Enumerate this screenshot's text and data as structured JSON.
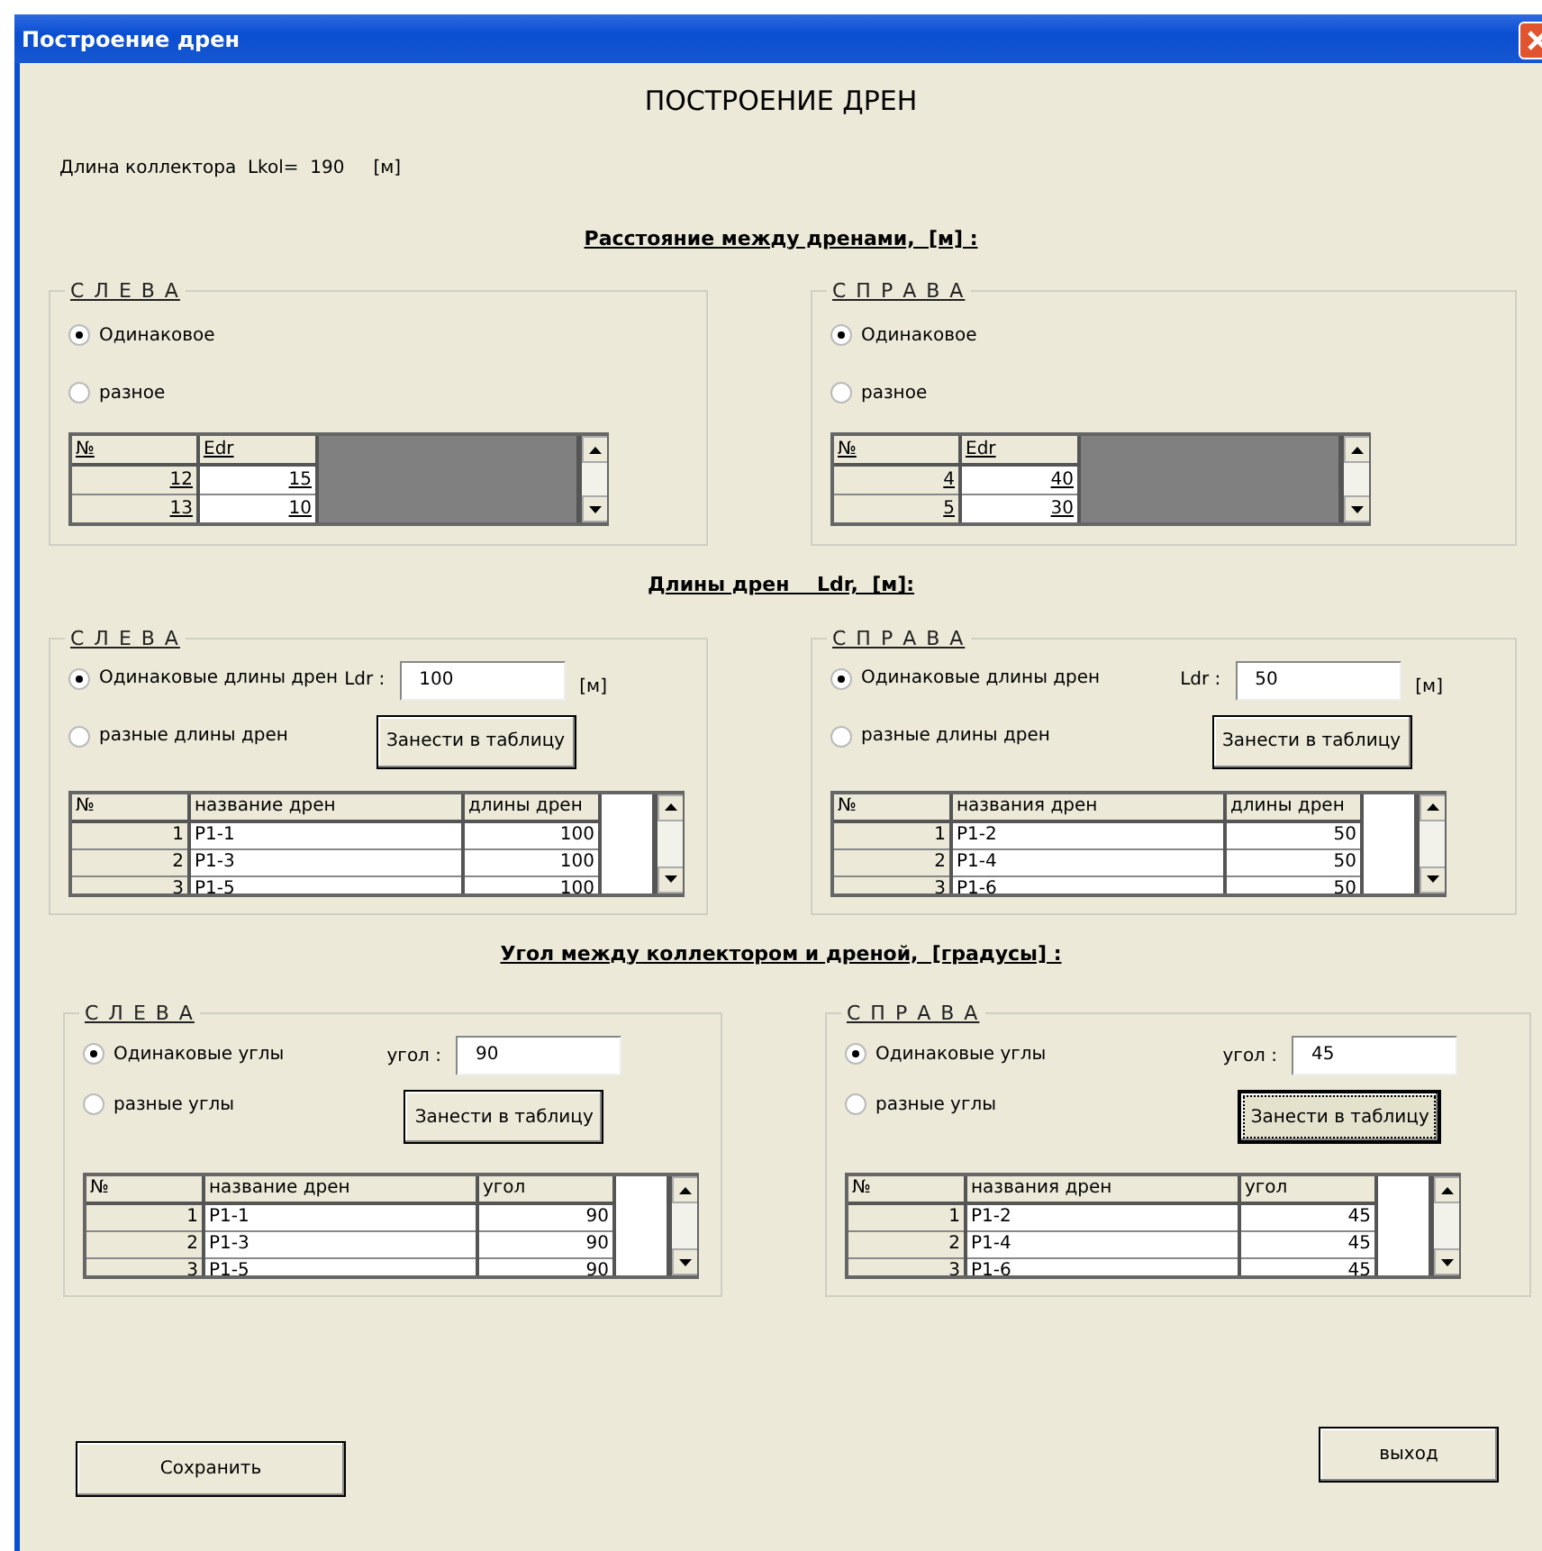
{
  "window": {
    "title": "Построение дрен"
  },
  "heading": "ПОСТРОЕНИЕ ДРЕН",
  "collector": {
    "label": "Длина коллектора  Lkol=  190",
    "unit": "[м]"
  },
  "sections": [
    {
      "title": "Расстояние между дренами,  [м] :",
      "groups": [
        {
          "legend": "С Л Е В А",
          "radios": [
            {
              "label": "Одинаковое",
              "selected": true
            },
            {
              "label": "разное",
              "selected": false
            }
          ],
          "grid": {
            "kind": "sheet",
            "columns": [
              "№",
              "Edr"
            ],
            "rows": [
              [
                "12",
                "15"
              ],
              [
                "13",
                "10"
              ]
            ]
          }
        },
        {
          "legend": "С П Р А В А",
          "radios": [
            {
              "label": "Одинаковое",
              "selected": true
            },
            {
              "label": "разное",
              "selected": false
            }
          ],
          "grid": {
            "kind": "sheet",
            "columns": [
              "№",
              "Edr"
            ],
            "rows": [
              [
                "4",
                "40"
              ],
              [
                "5",
                "30"
              ]
            ]
          }
        }
      ]
    },
    {
      "title": "Длины дрен    Ldr,  [м]:",
      "groups": [
        {
          "legend": "С Л Е В А",
          "radios": [
            {
              "label": "Одинаковые длины дрен",
              "selected": true
            },
            {
              "label": "разные длины дрен",
              "selected": false
            }
          ],
          "field": {
            "label": "Ldr :",
            "value": "100",
            "unit": "[м]"
          },
          "button": {
            "label": "Занести в таблицу",
            "focused": false
          },
          "grid": {
            "kind": "list",
            "columns": [
              "№",
              "название дрен",
              "длины дрен"
            ],
            "rows": [
              [
                "1",
                "P1-1",
                "100"
              ],
              [
                "2",
                "P1-3",
                "100"
              ],
              [
                "3",
                "P1-5",
                "100"
              ]
            ]
          }
        },
        {
          "legend": "С П Р А В А",
          "radios": [
            {
              "label": "Одинаковые длины дрен",
              "selected": true
            },
            {
              "label": "разные длины дрен",
              "selected": false
            }
          ],
          "field": {
            "label": "Ldr :",
            "value": "50",
            "unit": "[м]"
          },
          "button": {
            "label": "Занести в таблицу",
            "focused": false
          },
          "grid": {
            "kind": "list",
            "columns": [
              "№",
              "названия дрен",
              "длины дрен"
            ],
            "rows": [
              [
                "1",
                "P1-2",
                "50"
              ],
              [
                "2",
                "P1-4",
                "50"
              ],
              [
                "3",
                "P1-6",
                "50"
              ]
            ]
          }
        }
      ]
    },
    {
      "title": "Угол между коллектором и дреной,  [градусы] :",
      "groups": [
        {
          "legend": "С Л Е В А",
          "radios": [
            {
              "label": "Одинаковые углы",
              "selected": true
            },
            {
              "label": "разные углы",
              "selected": false
            }
          ],
          "field": {
            "label": "угол :",
            "value": "90"
          },
          "button": {
            "label": "Занести в таблицу",
            "focused": false
          },
          "grid": {
            "kind": "list",
            "columns": [
              "№",
              "название дрен",
              "угол"
            ],
            "rows": [
              [
                "1",
                "P1-1",
                "90"
              ],
              [
                "2",
                "P1-3",
                "90"
              ],
              [
                "3",
                "P1-5",
                "90"
              ]
            ]
          }
        },
        {
          "legend": "С П Р А В А",
          "radios": [
            {
              "label": "Одинаковые углы",
              "selected": true
            },
            {
              "label": "разные углы",
              "selected": false
            }
          ],
          "field": {
            "label": "угол :",
            "value": "45"
          },
          "button": {
            "label": "Занести в таблицу",
            "focused": true
          },
          "grid": {
            "kind": "list",
            "columns": [
              "№",
              "названия дрен",
              "угол"
            ],
            "rows": [
              [
                "1",
                "P1-2",
                "45"
              ],
              [
                "2",
                "P1-4",
                "45"
              ],
              [
                "3",
                "P1-6",
                "45"
              ]
            ]
          }
        }
      ]
    }
  ],
  "buttons": [
    {
      "label": "Сохранить"
    },
    {
      "label": "выход"
    }
  ]
}
